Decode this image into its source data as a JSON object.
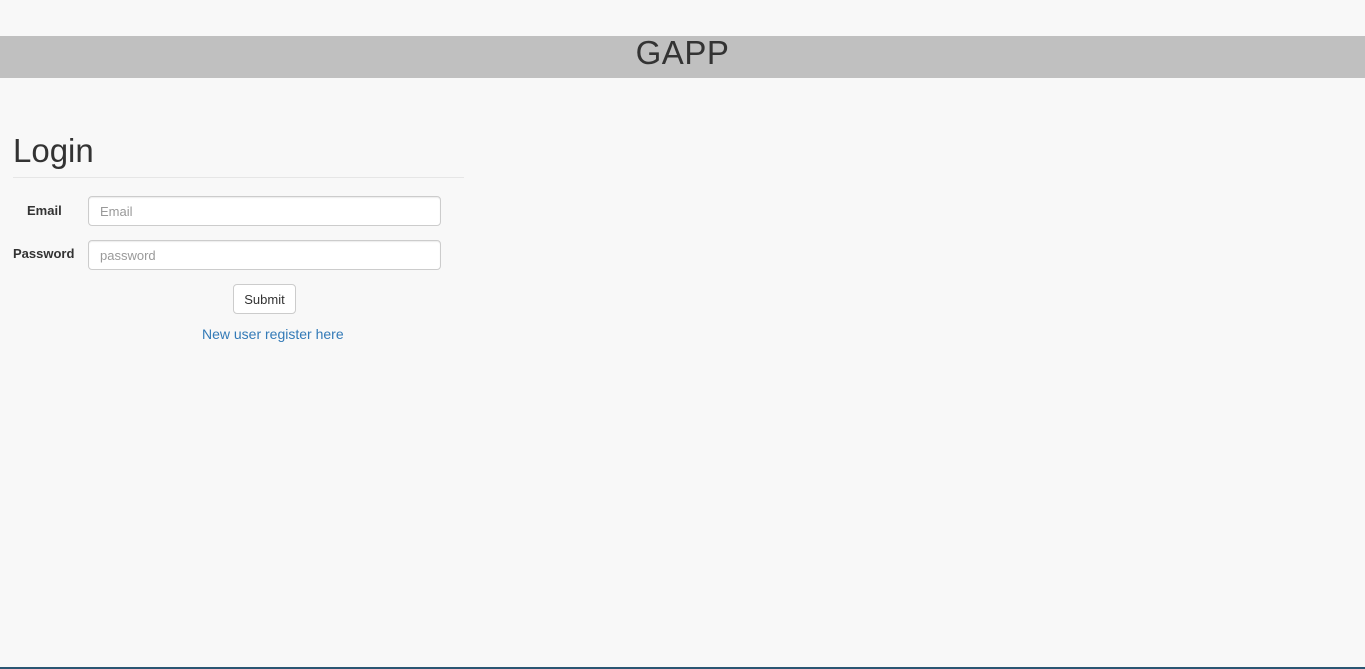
{
  "header": {
    "title": "GAPP"
  },
  "login": {
    "heading": "Login",
    "email": {
      "label": "Email",
      "value": "",
      "placeholder": "Email"
    },
    "password": {
      "label": "Password",
      "value": "",
      "placeholder": "password"
    },
    "submit_label": "Submit",
    "register_link": "New user register here"
  },
  "colors": {
    "background": "#f8f8f8",
    "header_bar": "#c0c0c0",
    "link": "#337ab7",
    "text": "#333333"
  }
}
